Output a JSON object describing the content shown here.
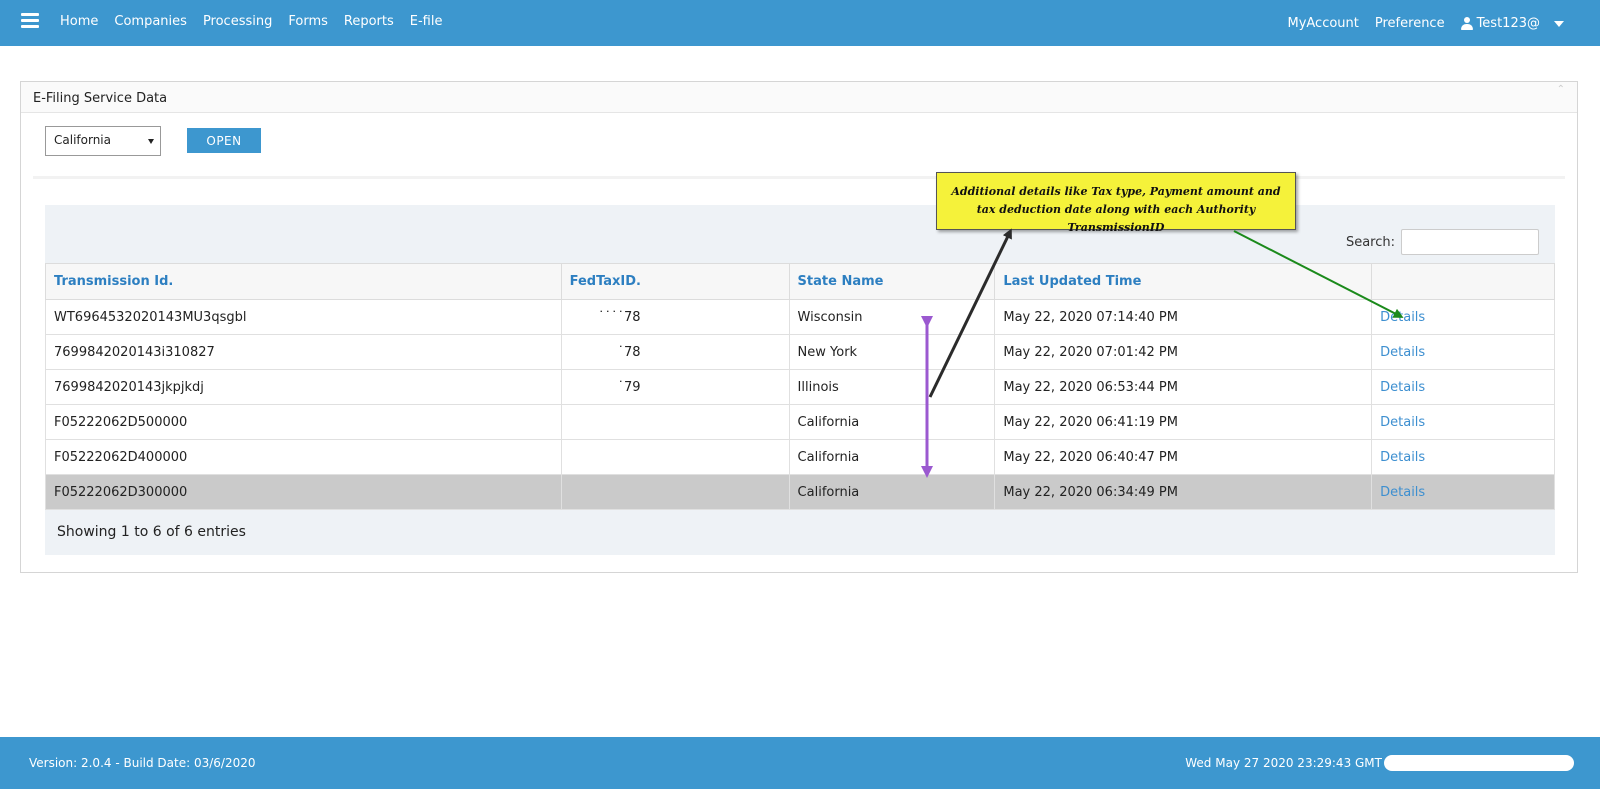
{
  "nav": {
    "items": [
      "Home",
      "Companies",
      "Processing",
      "Forms",
      "Reports",
      "E-file"
    ],
    "my_account": "MyAccount",
    "preference": "Preference",
    "user": "Test123@"
  },
  "panel": {
    "title": "E-Filing Service Data",
    "state_selected": "California",
    "open_label": "OPEN",
    "search_label": "Search:"
  },
  "table": {
    "headers": [
      "Transmission Id.",
      "FedTaxID.",
      "State Name",
      "Last Updated Time",
      ""
    ],
    "rows": [
      {
        "id": "WT6964532020143MU3qsgbl",
        "fed": "˙˙˙˙78",
        "state": "Wisconsin",
        "time": "May 22, 2020 07:14:40 PM",
        "details": "Details"
      },
      {
        "id": "7699842020143i310827",
        "fed": "˙78",
        "state": "New York",
        "time": "May 22, 2020 07:01:42 PM",
        "details": "Details"
      },
      {
        "id": "7699842020143jkpjkdj",
        "fed": "˙79",
        "state": "Illinois",
        "time": "May 22, 2020 06:53:44 PM",
        "details": "Details"
      },
      {
        "id": "F05222062D500000",
        "fed": "",
        "state": "California",
        "time": "May 22, 2020 06:41:19 PM",
        "details": "Details"
      },
      {
        "id": "F05222062D400000",
        "fed": "",
        "state": "California",
        "time": "May 22, 2020 06:40:47 PM",
        "details": "Details"
      },
      {
        "id": "F05222062D300000",
        "fed": "",
        "state": "California",
        "time": "May 22, 2020 06:34:49 PM",
        "details": "Details"
      }
    ],
    "entries": "Showing 1 to 6 of 6 entries"
  },
  "annotation": {
    "text": "Additional details like  Tax type, Payment amount and tax deduction date along with each Authority TransmissionID"
  },
  "footer": {
    "version": "Version: 2.0.4 - Build Date: 03/6/2020",
    "datetime": "Wed May 27 2020 23:29:43 GMT"
  },
  "colors": {
    "brand": "#3d97cf",
    "header_text": "#2d7fc1",
    "callout": "#f5f23a",
    "arrow_black": "#2b2b2b",
    "arrow_green": "#1b8a1b",
    "arrow_purple": "#9b59d0"
  },
  "icons": [
    "menu-icon",
    "user-icon",
    "chevron-down-icon"
  ]
}
